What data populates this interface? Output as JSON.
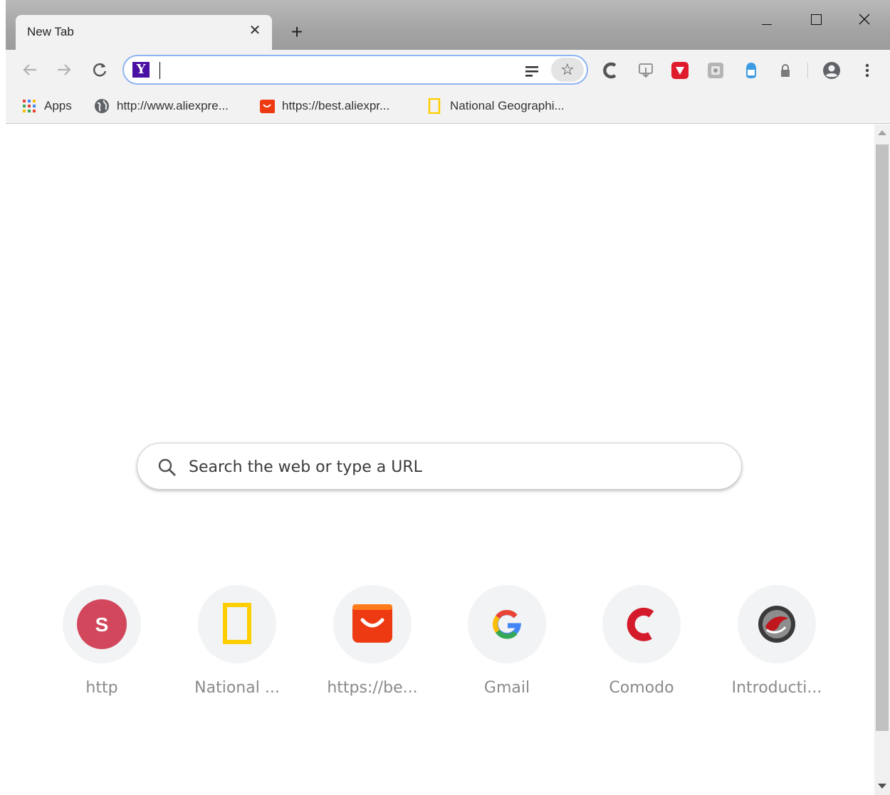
{
  "tab": {
    "title": "New Tab"
  },
  "omnibox": {
    "value": ""
  },
  "bookmarks": [
    {
      "label": "Apps",
      "icon": "apps-grid-icon"
    },
    {
      "label": "http://www.aliexpre...",
      "icon": "globe-icon"
    },
    {
      "label": "https://best.aliexpr...",
      "icon": "aliexpress-bag-icon"
    },
    {
      "label": "National Geographi...",
      "icon": "natgeo-icon"
    }
  ],
  "search": {
    "placeholder": "Search the web or type a URL"
  },
  "shortcuts": [
    {
      "label": "http",
      "icon": "letter-s-icon",
      "letter": "S",
      "color": "#d2475c"
    },
    {
      "label": "National ...",
      "icon": "natgeo-icon",
      "color": "#ffce00"
    },
    {
      "label": "https://be...",
      "icon": "aliexpress-bag-icon",
      "color": "#ee3a12"
    },
    {
      "label": "Gmail",
      "icon": "google-g-icon"
    },
    {
      "label": "Comodo",
      "icon": "comodo-icon",
      "color": "#d41b2c"
    },
    {
      "label": "Introducti...",
      "icon": "dragon-icon",
      "color": "#c0161d"
    }
  ]
}
